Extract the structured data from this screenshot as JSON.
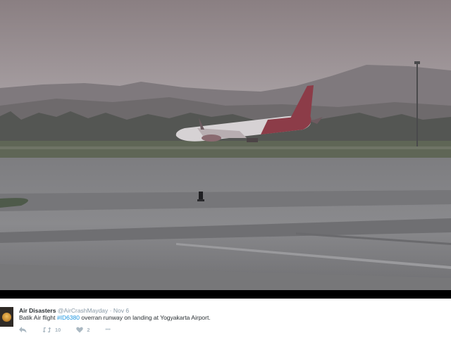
{
  "tweet": {
    "author_name": "Air Disasters",
    "author_handle": "@AirCrashMayday",
    "separator": "·",
    "date": "Nov 6",
    "text_before": "Batik Air flight ",
    "hashtag": "#ID6380",
    "text_after": " overran runway on landing at Yogyakarta Airport.",
    "retweet_count": "10",
    "like_count": "2",
    "more_label": "•••"
  },
  "colors": {
    "hashtag": "#1b95e0",
    "name": "#292f33",
    "muted": "#8899a6",
    "action_icons": "#aab8c2"
  },
  "icons": {
    "reply": "reply-icon",
    "retweet": "retweet-icon",
    "like": "heart-icon",
    "more": "more-icon"
  }
}
